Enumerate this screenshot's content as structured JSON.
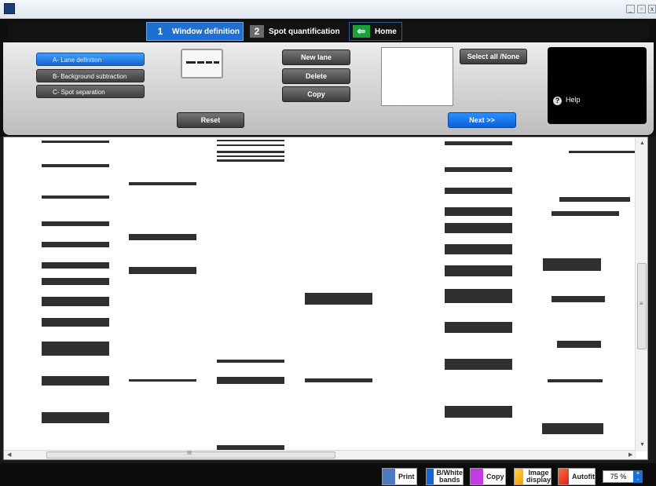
{
  "header": {
    "tabs": [
      {
        "num": "1",
        "label": "Window definition"
      },
      {
        "num": "2",
        "label": "Spot quantification"
      },
      {
        "label": "Home"
      }
    ]
  },
  "modes": [
    "A- Lane definition",
    "B- Background subtraction",
    "C- Spot separation"
  ],
  "buttons": {
    "new_lane": "New lane",
    "delete": "Delete",
    "copy": "Copy",
    "reset": "Reset",
    "select_all": "Select all /None",
    "next": "Next >>",
    "help": "Help"
  },
  "scroll": {
    "h_label": "III",
    "v_label": "≡"
  },
  "toolbar": {
    "print": "Print",
    "bw_line1": "B/White",
    "bw_line2": "bands",
    "copy": "Copy",
    "image_line1": "Image",
    "image_line2": "display",
    "autofit": "Autofit",
    "zoom": "75 %"
  },
  "colors": {
    "accent": "#1f6fd1",
    "home": "#18a23a",
    "band": "#2f2f2f"
  }
}
